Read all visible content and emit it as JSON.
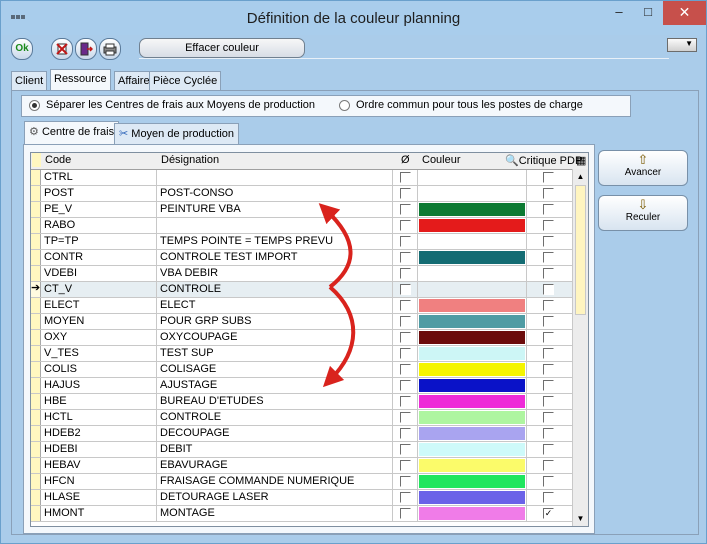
{
  "window": {
    "title": "Définition de la couleur planning",
    "minimize": "–",
    "maximize": "□",
    "close": "✕"
  },
  "toolbar": {
    "ok_label": "Ok",
    "clear_color_label": "Effacer couleur"
  },
  "tabs": [
    {
      "label": "Client",
      "active": false
    },
    {
      "label": "Ressource",
      "active": true
    },
    {
      "label": "Affaire",
      "active": false
    },
    {
      "label": "Pièce Cyclée",
      "active": false
    }
  ],
  "radio": {
    "option1": "Séparer les Centres de frais aux Moyens de production",
    "option2": "Ordre commun pour tous les postes de charge",
    "selected": 1
  },
  "subtabs": [
    {
      "label": "Centre de frais",
      "active": true
    },
    {
      "label": "Moyen de production",
      "active": false
    }
  ],
  "grid": {
    "headers": {
      "code": "Code",
      "designation": "Désignation",
      "flag": "Ø",
      "color": "Couleur",
      "critical": "Critique PDP"
    },
    "rows": [
      {
        "code": "CTRL",
        "designation": "",
        "color": "#ffffff",
        "critical": false,
        "selected": false
      },
      {
        "code": "POST",
        "designation": "POST-CONSO",
        "color": "#ffffff",
        "critical": false,
        "selected": false
      },
      {
        "code": "PE_V",
        "designation": "PEINTURE VBA",
        "color": "#0c7a32",
        "critical": false,
        "selected": false
      },
      {
        "code": "RABO",
        "designation": "",
        "color": "#e41b1b",
        "critical": false,
        "selected": false
      },
      {
        "code": "TP=TP",
        "designation": "TEMPS POINTE = TEMPS PREVU",
        "color": "#ffffff",
        "critical": false,
        "selected": false
      },
      {
        "code": "CONTR",
        "designation": "CONTROLE TEST IMPORT",
        "color": "#146c73",
        "critical": false,
        "selected": false
      },
      {
        "code": "VDEBI",
        "designation": "VBA DEBIR",
        "color": "#ffffff",
        "critical": false,
        "selected": false
      },
      {
        "code": "CT_V",
        "designation": "CONTROLE",
        "color": "#e6eef2",
        "critical": false,
        "selected": true
      },
      {
        "code": "ELECT",
        "designation": "ELECT",
        "color": "#f08080",
        "critical": false,
        "selected": false
      },
      {
        "code": "MOYEN",
        "designation": "POUR GRP SUBS",
        "color": "#4f9ca4",
        "critical": false,
        "selected": false
      },
      {
        "code": "OXY",
        "designation": "OXYCOUPAGE",
        "color": "#6b0b0b",
        "critical": false,
        "selected": false
      },
      {
        "code": "V_TES",
        "designation": "TEST SUP",
        "color": "#cdf6f6",
        "critical": false,
        "selected": false
      },
      {
        "code": "COLIS",
        "designation": "COLISAGE",
        "color": "#f5f500",
        "critical": false,
        "selected": false
      },
      {
        "code": "HAJUS",
        "designation": "AJUSTAGE",
        "color": "#0a12c8",
        "critical": false,
        "selected": false
      },
      {
        "code": "HBE",
        "designation": "BUREAU D'ETUDES",
        "color": "#ee2ad8",
        "critical": false,
        "selected": false
      },
      {
        "code": "HCTL",
        "designation": "CONTROLE",
        "color": "#aef5a0",
        "critical": false,
        "selected": false
      },
      {
        "code": "HDEB2",
        "designation": "DECOUPAGE",
        "color": "#a9a4f0",
        "critical": false,
        "selected": false
      },
      {
        "code": "HDEBI",
        "designation": "DEBIT",
        "color": "#cefafa",
        "critical": false,
        "selected": false
      },
      {
        "code": "HEBAV",
        "designation": "EBAVURAGE",
        "color": "#fbfb6a",
        "critical": false,
        "selected": false
      },
      {
        "code": "HFCN",
        "designation": "FRAISAGE COMMANDE NUMERIQUE",
        "color": "#20e65e",
        "critical": false,
        "selected": false
      },
      {
        "code": "HLASE",
        "designation": "DETOURAGE LASER",
        "color": "#6b62e8",
        "critical": false,
        "selected": false
      },
      {
        "code": "HMONT",
        "designation": "MONTAGE",
        "color": "#f07ce8",
        "critical": true,
        "selected": false
      }
    ]
  },
  "side": {
    "advance_label": "Avancer",
    "back_label": "Reculer"
  },
  "colors": {
    "accent": "#aaccea",
    "indicator": "#fff7c0",
    "arrow": "#d9231d"
  }
}
